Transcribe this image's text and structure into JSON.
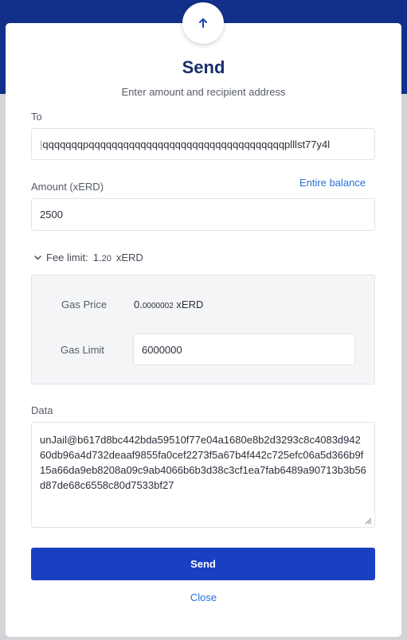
{
  "modal": {
    "title": "Send",
    "subtitle": "Enter amount and recipient address",
    "icon": "arrow-up-icon"
  },
  "to": {
    "label": "To",
    "value": "qqqqqqqpqqqqqqqqqqqqqqqqqqqqqqqqqqqqqqqqqqplllst77y4l"
  },
  "amount": {
    "label": "Amount (xERD)",
    "entire_balance_label": "Entire balance",
    "value": "2500"
  },
  "fee": {
    "toggle_label": "Fee limit:",
    "limit_int": "1.",
    "limit_dec": "20",
    "unit": "xERD",
    "gas_price_label": "Gas Price",
    "gas_price_int": "0.",
    "gas_price_dec": "0000002",
    "gas_price_unit": "xERD",
    "gas_limit_label": "Gas Limit",
    "gas_limit_value": "6000000"
  },
  "data": {
    "label": "Data",
    "value": "unJail@b617d8bc442bda59510f77e04a1680e8b2d3293c8c4083d94260db96a4d732deaaf9855fa0cef2273f5a67b4f442c725efc06a5d366b9f15a66da9eb8208a09c9ab4066b6b3d38c3cf1ea7fab6489a90713b3b56d87de68c6558c80d7533bf27"
  },
  "actions": {
    "send_label": "Send",
    "close_label": "Close"
  },
  "colors": {
    "header_bg": "#12308a",
    "primary_button": "#1a40c2",
    "link": "#2a6fd6",
    "title": "#1a2e6d"
  }
}
